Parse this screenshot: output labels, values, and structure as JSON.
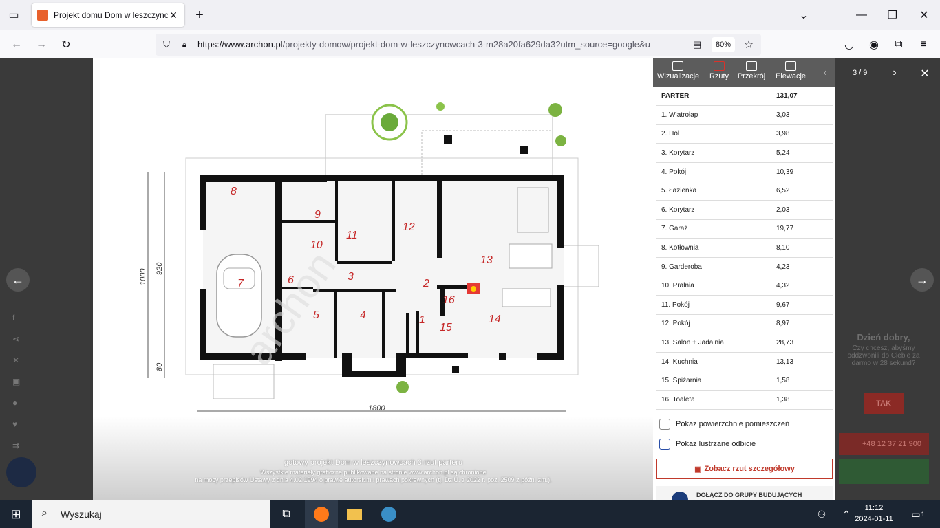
{
  "browser": {
    "tab_title": "Projekt domu Dom w leszczync",
    "url_host": "https://www.archon.pl",
    "url_path": "/projekty-domow/projekt-dom-w-leszczynowcach-3-m28a20fa629da3?utm_source=google&u",
    "zoom": "80%"
  },
  "viewer": {
    "tabs": [
      {
        "label": "Wizualizacje"
      },
      {
        "label": "Rzuty"
      },
      {
        "label": "Przekrój"
      },
      {
        "label": "Elewacje"
      }
    ],
    "pager": "3 / 9",
    "caption_title": "gotowy projekt Dom w leszczynowcach 3 rzut parteru",
    "caption_line1": "Wszystkie materiały graficzne publikowane na stronie www.archon.pl są chronione",
    "caption_line2": "na mocy przepisów Ustawy z dnia 4.02.1994 o prawie autorskim i prawach pokrewnych (tj. Dz.U. z 2022 r. poz. 2509 z późn. zm.).",
    "watermark": "archon",
    "dim_total_width": "1800",
    "dim_height_1": "1000",
    "dim_height_2": "920",
    "dim_height_3": "80"
  },
  "rooms_table": {
    "header": {
      "name": "PARTER",
      "area": "131,07"
    },
    "rows": [
      {
        "name": "1. Wiatrołap",
        "area": "3,03"
      },
      {
        "name": "2. Hol",
        "area": "3,98"
      },
      {
        "name": "3. Korytarz",
        "area": "5,24"
      },
      {
        "name": "4. Pokój",
        "area": "10,39"
      },
      {
        "name": "5. Łazienka",
        "area": "6,52"
      },
      {
        "name": "6. Korytarz",
        "area": "2,03"
      },
      {
        "name": "7. Garaż",
        "area": "19,77"
      },
      {
        "name": "8. Kotłownia",
        "area": "8,10"
      },
      {
        "name": "9. Garderoba",
        "area": "4,23"
      },
      {
        "name": "10. Pralnia",
        "area": "4,32"
      },
      {
        "name": "11. Pokój",
        "area": "9,67"
      },
      {
        "name": "12. Pokój",
        "area": "8,97"
      },
      {
        "name": "13. Salon + Jadalnia",
        "area": "28,73"
      },
      {
        "name": "14. Kuchnia",
        "area": "13,13"
      },
      {
        "name": "15. Spiżarnia",
        "area": "1,58"
      },
      {
        "name": "16. Toaleta",
        "area": "1,38"
      }
    ]
  },
  "options": {
    "show_areas": "Pokaż powierzchnie pomieszczeń",
    "mirror": "Pokaż lustrzane odbicie",
    "detailed_btn": "Zobacz rzut szczegółowy",
    "fb_group": "DOŁĄCZ DO GRUPY BUDUJĄCYCH"
  },
  "chat": {
    "greeting": "Dzień dobry,",
    "question": "Czy chcesz, abyśmy oddzwonili do Ciebie za darmo w 28 sekund?",
    "yes": "TAK",
    "phone": "+48 12 37 21 900"
  },
  "taskbar": {
    "search_placeholder": "Wyszukaj",
    "time": "11:12",
    "date": "2024-01-11",
    "notifications": "1"
  }
}
